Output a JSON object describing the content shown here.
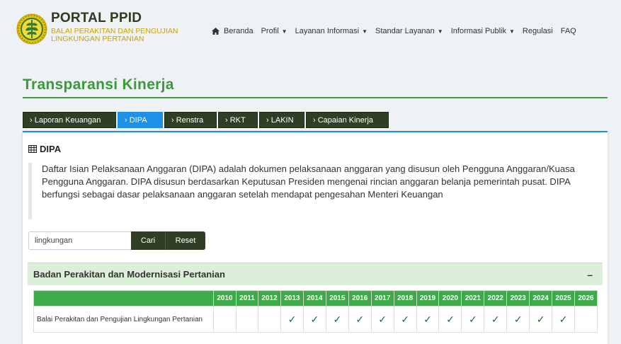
{
  "brand": {
    "title": "PORTAL PPID",
    "subtitle": "BALAI PERAKITAN DAN PENGUJIAN LINGKUNGAN PERTANIAN"
  },
  "nav": [
    {
      "label": "Beranda",
      "icon": "home-icon",
      "dropdown": false
    },
    {
      "label": "Profil",
      "dropdown": true
    },
    {
      "label": "Layanan Informasi",
      "dropdown": true
    },
    {
      "label": "Standar Layanan",
      "dropdown": true
    },
    {
      "label": "Informasi Publik",
      "dropdown": true
    },
    {
      "label": "Regulasi",
      "dropdown": false
    },
    {
      "label": "FAQ",
      "dropdown": false
    }
  ],
  "page_title": "Transparansi Kinerja",
  "tabs": [
    {
      "label": "Laporan Keuangan",
      "active": false
    },
    {
      "label": "DIPA",
      "active": true
    },
    {
      "label": "Renstra",
      "active": false
    },
    {
      "label": "RKT",
      "active": false
    },
    {
      "label": "LAKIN",
      "active": false
    },
    {
      "label": "Capaian Kinerja",
      "active": false
    }
  ],
  "panel": {
    "heading": "DIPA",
    "description": "Daftar Isian Pelaksanaan Anggaran (DIPA) adalah dokumen pelaksanaan anggaran yang disusun oleh Pengguna Anggaran/Kuasa Pengguna Anggaran. DIPA disusun berdasarkan Keputusan Presiden mengenai rincian anggaran belanja pemerintah pusat. DIPA berfungsi sebagai dasar pelaksanaan anggaran setelah mendapat pengesahan Menteri Keuangan"
  },
  "search": {
    "value": "lingkungan",
    "search_label": "Cari",
    "reset_label": "Reset"
  },
  "group": {
    "label": "Badan Perakitan dan Modernisasi Pertanian",
    "toggle": "–"
  },
  "table": {
    "years": [
      "2010",
      "2011",
      "2012",
      "2013",
      "2014",
      "2015",
      "2016",
      "2017",
      "2018",
      "2019",
      "2020",
      "2021",
      "2022",
      "2023",
      "2024",
      "2025",
      "2026"
    ],
    "rows": [
      {
        "name": "Balai Perakitan dan Pengujian Lingkungan Pertanian",
        "checked": [
          false,
          false,
          false,
          true,
          true,
          true,
          true,
          true,
          true,
          true,
          true,
          true,
          true,
          true,
          true,
          true,
          false
        ]
      }
    ]
  },
  "colors": {
    "accent_green": "#3fa040",
    "tab_dark": "#2f3f25",
    "tab_active": "#1e90e8",
    "brand_gold": "#c9a200"
  }
}
